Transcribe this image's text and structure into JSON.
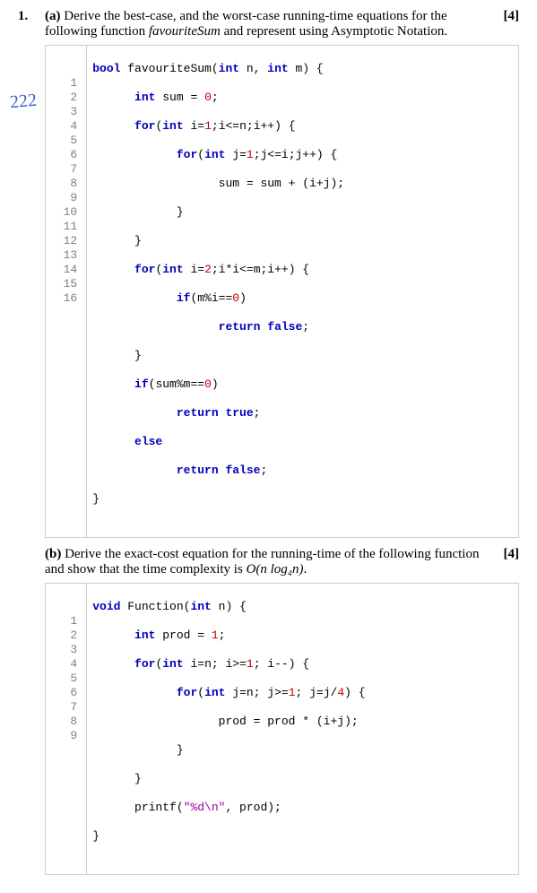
{
  "question_number": "1.",
  "part_a": {
    "label": "(a)",
    "text_before_fn": "Derive the best-case, and the worst-case running-time equations for the following function ",
    "fn_name": "favouriteSum",
    "text_after_fn": " and represent using Asymptotic Notation.",
    "marks": "[4]"
  },
  "code_a": {
    "line_count": 16,
    "tokens": {
      "l1": [
        "bool ",
        "favouriteSum(",
        "int ",
        "n, ",
        "int ",
        "m) {"
      ],
      "l2": [
        "      ",
        "int ",
        "sum = ",
        "0",
        ";"
      ],
      "l3": [
        "      ",
        "for",
        "(",
        "int ",
        "i=",
        "1",
        ";i<=n;i++) {"
      ],
      "l4": [
        "            ",
        "for",
        "(",
        "int ",
        "j=",
        "1",
        ";j<=i;j++) {"
      ],
      "l5": [
        "                  sum = sum + (i+j);"
      ],
      "l6": [
        "            }"
      ],
      "l7": [
        "      }"
      ],
      "l8": [
        "      ",
        "for",
        "(",
        "int ",
        "i=",
        "2",
        ";i*i<=m;i++) {"
      ],
      "l9": [
        "            ",
        "if",
        "(m%i==",
        "0",
        ")"
      ],
      "l10": [
        "                  ",
        "return false",
        ";"
      ],
      "l11": [
        "      }"
      ],
      "l12": [
        "      ",
        "if",
        "(sum%m==",
        "0",
        ")"
      ],
      "l13": [
        "            ",
        "return true",
        ";"
      ],
      "l14": [
        "      ",
        "else"
      ],
      "l15": [
        "            ",
        "return false",
        ";"
      ],
      "l16": [
        "}"
      ]
    }
  },
  "annotation": "222",
  "part_b": {
    "label": "(b)",
    "text": "Derive the exact-cost equation for the running-time of the following function and show that the time complexity is ",
    "complexity": "O(n log₄n)",
    "text_after": ".",
    "marks": "[4]"
  },
  "code_b": {
    "line_count": 9,
    "tokens": {
      "l1": [
        "void ",
        "Function(",
        "int ",
        "n) {"
      ],
      "l2": [
        "      ",
        "int ",
        "prod = ",
        "1",
        ";"
      ],
      "l3": [
        "      ",
        "for",
        "(",
        "int ",
        "i=n; i>=",
        "1",
        "; i--) {"
      ],
      "l4": [
        "            ",
        "for",
        "(",
        "int ",
        "j=n; j>=",
        "1",
        "; j=j/",
        "4",
        ") {"
      ],
      "l5": [
        "                  prod = prod * (i+j);"
      ],
      "l6": [
        "            }"
      ],
      "l7": [
        "      }"
      ],
      "l8": [
        "      printf(",
        "\"%d\\n\"",
        ", prod);"
      ],
      "l9": [
        "}"
      ]
    }
  }
}
